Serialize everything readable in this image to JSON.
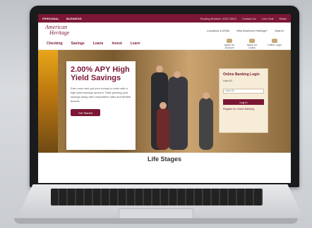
{
  "website": {
    "topbar": {
      "left_tabs": [
        "PERSONAL",
        "BUSINESS"
      ],
      "right_items": [
        "Routing Number: 221172610",
        "Contact Us",
        "Live Chat",
        "Rates"
      ]
    },
    "header": {
      "logo_line1": "American",
      "logo_line2": "Heritage",
      "links": [
        "Locations & ATMs",
        "Why American Heritage?",
        "Search"
      ]
    },
    "nav": {
      "items": [
        "Checking",
        "Savings",
        "Loans",
        "Invest",
        "Learn"
      ],
      "quick_actions": [
        {
          "label": "Apply for Account"
        },
        {
          "label": "Apply for Loans"
        },
        {
          "label": "Online Login"
        }
      ]
    },
    "hero": {
      "title": "2.00% APY High Yield Savings",
      "body": "Earn more and put your money to work with a high yield savings account. Start growing your savings today with competitive rates and flexible access.",
      "cta": "Get Started"
    },
    "login": {
      "title": "Online Banking Login",
      "username_label": "User ID",
      "username_placeholder": "User ID",
      "button": "Log In",
      "register": "Register for Online Banking"
    },
    "section_title": "Life Stages"
  }
}
